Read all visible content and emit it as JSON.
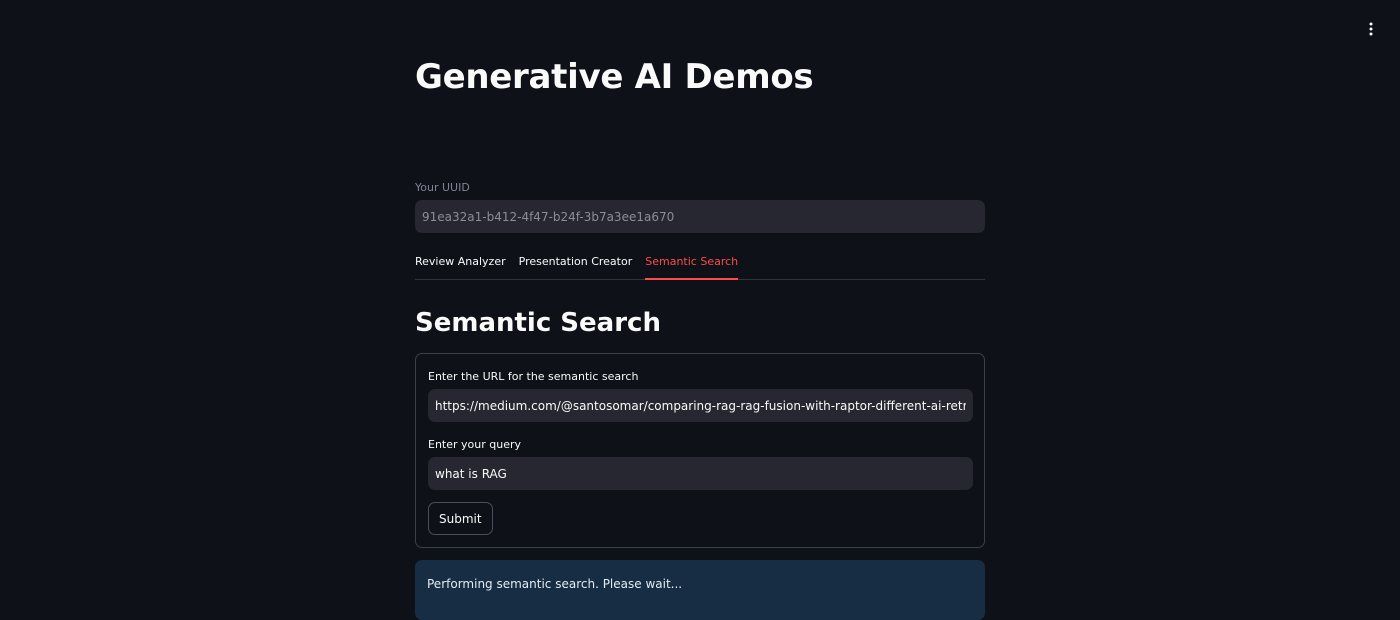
{
  "header": {
    "menu_icon": "kebab-vertical-icon"
  },
  "page": {
    "title": "Generative AI Demos"
  },
  "uuid": {
    "label": "Your UUID",
    "value": "91ea32a1-b412-4f47-b24f-3b7a3ee1a670"
  },
  "tabs": [
    {
      "label": "Review Analyzer",
      "active": false
    },
    {
      "label": "Presentation Creator",
      "active": false
    },
    {
      "label": "Semantic Search",
      "active": true
    }
  ],
  "section": {
    "title": "Semantic Search"
  },
  "form": {
    "url_label": "Enter the URL for the semantic search",
    "url_value": "https://medium.com/@santosomar/comparing-rag-rag-fusion-with-raptor-different-ai-retrieval-au",
    "query_label": "Enter your query",
    "query_value": "what is RAG",
    "submit_label": "Submit"
  },
  "status": {
    "message": "Performing semantic search. Please wait..."
  },
  "colors": {
    "background": "#0e1117",
    "accent": "#ff4b4b",
    "input_bg": "#262730",
    "info_bg": "#172d43"
  }
}
